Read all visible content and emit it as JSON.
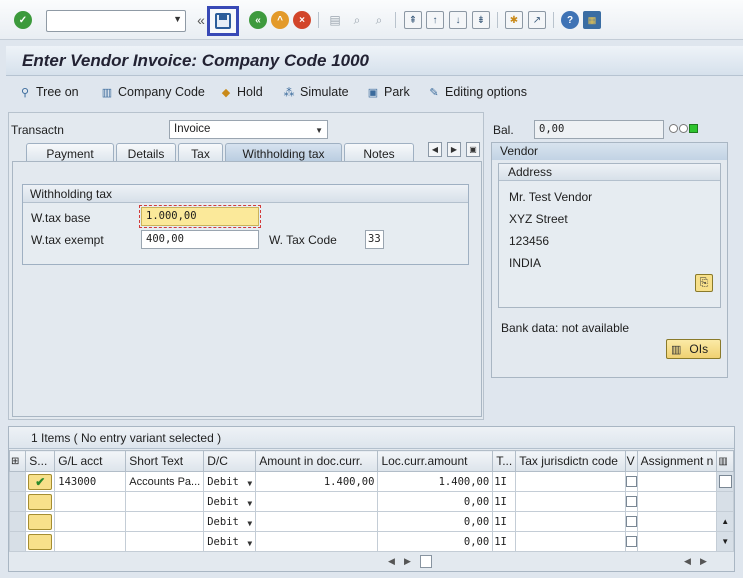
{
  "toolbar": {
    "command_field_value": "",
    "double_left": "«",
    "icons": [
      "enter-icon",
      "save-icon",
      "back-icon",
      "exit-icon",
      "cancel-icon",
      "print-icon",
      "find-icon",
      "find-next-icon",
      "first-page-icon",
      "prev-page-icon",
      "next-page-icon",
      "last-page-icon",
      "create-session-icon",
      "shortcut-icon",
      "help-icon",
      "layout-icon"
    ]
  },
  "title": "Enter Vendor Invoice: Company Code 1000",
  "app_toolbar": {
    "tree_on": "Tree on",
    "company_code": "Company Code",
    "hold": "Hold",
    "simulate": "Simulate",
    "park": "Park",
    "editing_options": "Editing options"
  },
  "header": {
    "transaction_label": "Transactn",
    "transaction_value": "Invoice",
    "balance_label": "Bal.",
    "balance_value": "0,00"
  },
  "tabs": [
    "Payment",
    "Details",
    "Tax",
    "Withholding tax",
    "Notes"
  ],
  "active_tab": "Withholding tax",
  "withholding": {
    "group_title": "Withholding tax",
    "wtax_base_label": "W.tax base",
    "wtax_base_value": "1.000,00",
    "wtax_exempt_label": "W.tax exempt",
    "wtax_exempt_value": "400,00",
    "wtax_code_label": "W. Tax Code",
    "wtax_code_value": "33"
  },
  "vendor": {
    "title": "Vendor",
    "address_title": "Address",
    "name": "Mr. Test Vendor",
    "street": "XYZ Street",
    "postal": "123456",
    "country": "INDIA",
    "bank_data": "Bank data: not available",
    "ois_button": "OIs"
  },
  "items": {
    "title": "1 Items ( No entry variant selected )",
    "columns": [
      "S...",
      "G/L acct",
      "Short Text",
      "D/C",
      "Amount in doc.curr.",
      "Loc.curr.amount",
      "T...",
      "Tax jurisdictn code",
      "V",
      "Assignment n"
    ],
    "rows": [
      {
        "status": "check",
        "gl": "143000",
        "text": "Accounts Pa...",
        "dc": "Debit",
        "amount": "1.400,00",
        "loc": "1.400,00",
        "t": "1I",
        "jur": "",
        "v": "",
        "assign": ""
      },
      {
        "status": "empty",
        "gl": "",
        "text": "",
        "dc": "Debit",
        "amount": "",
        "loc": "0,00",
        "t": "1I",
        "jur": "",
        "v": "",
        "assign": ""
      },
      {
        "status": "empty",
        "gl": "",
        "text": "",
        "dc": "Debit",
        "amount": "",
        "loc": "0,00",
        "t": "1I",
        "jur": "",
        "v": "",
        "assign": ""
      },
      {
        "status": "empty",
        "gl": "",
        "text": "",
        "dc": "Debit",
        "amount": "",
        "loc": "0,00",
        "t": "1I",
        "jur": "",
        "v": "",
        "assign": ""
      }
    ]
  },
  "colors": {
    "accent": "#3849b6",
    "field_highlight": "#fbe99a",
    "status_green": "#2a8a2a"
  }
}
